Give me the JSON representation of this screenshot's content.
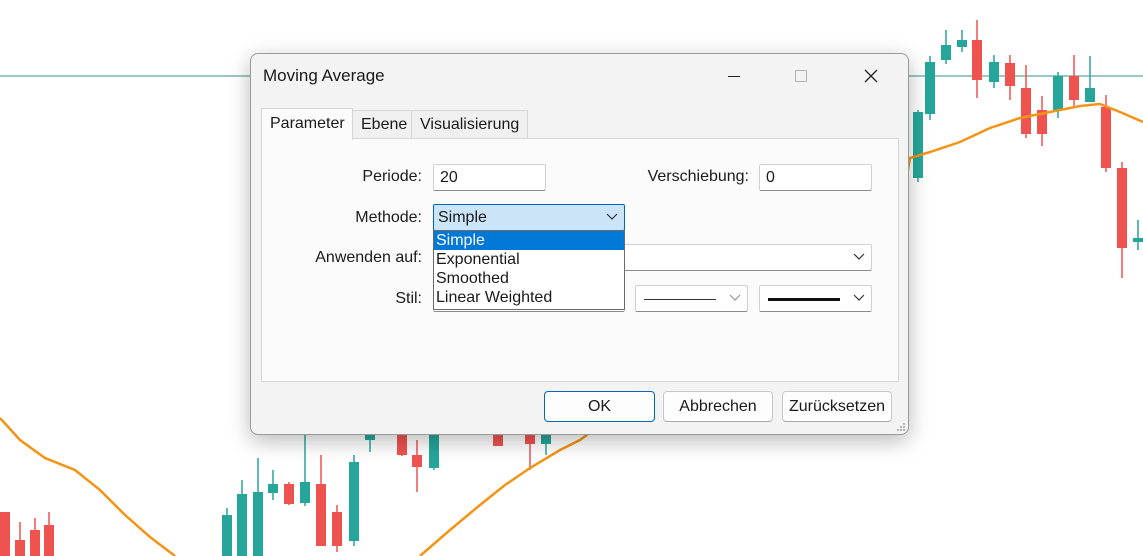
{
  "dialog": {
    "title": "Moving Average",
    "tabs": [
      {
        "label": "Parameter",
        "active": true
      },
      {
        "label": "Ebene",
        "active": false
      },
      {
        "label": "Visualisierung",
        "active": false
      }
    ],
    "period_label": "Periode:",
    "period_value": "20",
    "shift_label": "Verschiebung:",
    "shift_value": "0",
    "method_label": "Methode:",
    "method_value": "Simple",
    "method_options": [
      "Simple",
      "Exponential",
      "Smoothed",
      "Linear Weighted"
    ],
    "apply_label": "Anwenden auf:",
    "style_label": "Stil:",
    "buttons": {
      "ok": "OK",
      "cancel": "Abbrechen",
      "reset": "Zurücksetzen"
    }
  },
  "colors": {
    "bull": "#26a69a",
    "bear": "#ef5350",
    "ma_line": "#f39416",
    "level_line": "#3a8f8f",
    "accent": "#0078d7"
  },
  "icons": [
    "minimize-icon",
    "maximize-icon",
    "close-icon",
    "chevron-down-icon",
    "resize-grip-icon"
  ]
}
